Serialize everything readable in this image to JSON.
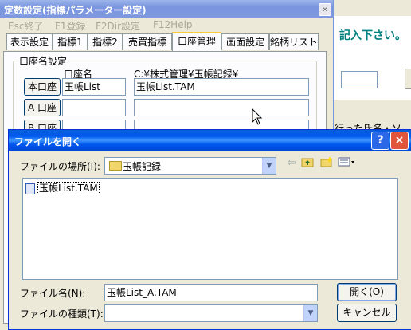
{
  "background_app": {
    "instruction_text": "記入下さい。",
    "partial_text": "行った氏名・ソ"
  },
  "settings_window": {
    "title": "定数設定(指標パラメーター設定)",
    "close_label": "×",
    "menu": [
      "Esc終了",
      "F1登録",
      "F2Dir設定",
      "F12Help"
    ],
    "tabs": [
      "表示設定",
      "指標1",
      "指標2",
      "売買指標",
      "口座管理",
      "画面設定",
      "銘柄リスト"
    ],
    "selected_tab": "口座管理",
    "group_label": "口座名設定",
    "col_account_name": "口座名",
    "col_path": "C:¥株式管理¥玉帳記録¥",
    "rows": [
      {
        "button": "本口座",
        "name": "玉帳List",
        "file": "玉帳List.TAM"
      },
      {
        "button": "A 口座",
        "name": "",
        "file": ""
      },
      {
        "button": "B 口座",
        "name": "",
        "file": ""
      }
    ]
  },
  "file_dialog": {
    "title": "ファイルを開く",
    "help_label": "?",
    "close_label": "×",
    "look_in_label": "ファイルの場所(I):",
    "look_in_value": "玉帳記録",
    "files": [
      "玉帳List.TAM"
    ],
    "filename_label": "ファイル名(N):",
    "filename_value": "玉帳List_A.TAM",
    "filetype_label": "ファイルの種類(T):",
    "filetype_value": "",
    "open_label": "開く(O)",
    "cancel_label": "キャンセル"
  }
}
